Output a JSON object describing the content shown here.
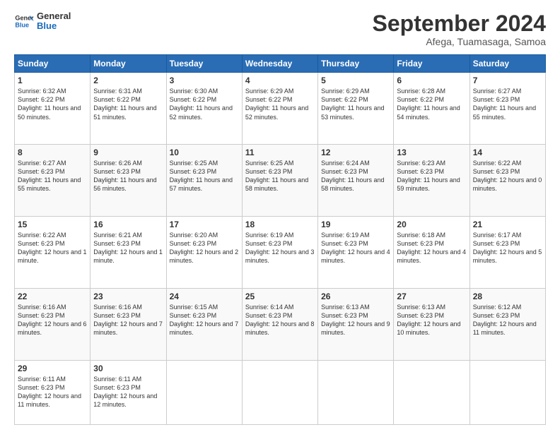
{
  "header": {
    "logo_text_general": "General",
    "logo_text_blue": "Blue",
    "title": "September 2024",
    "subtitle": "Afega, Tuamasaga, Samoa"
  },
  "weekdays": [
    "Sunday",
    "Monday",
    "Tuesday",
    "Wednesday",
    "Thursday",
    "Friday",
    "Saturday"
  ],
  "weeks": [
    [
      {
        "day": "1",
        "sunrise": "6:32 AM",
        "sunset": "6:22 PM",
        "daylight": "11 hours and 50 minutes."
      },
      {
        "day": "2",
        "sunrise": "6:31 AM",
        "sunset": "6:22 PM",
        "daylight": "11 hours and 51 minutes."
      },
      {
        "day": "3",
        "sunrise": "6:30 AM",
        "sunset": "6:22 PM",
        "daylight": "11 hours and 52 minutes."
      },
      {
        "day": "4",
        "sunrise": "6:29 AM",
        "sunset": "6:22 PM",
        "daylight": "11 hours and 52 minutes."
      },
      {
        "day": "5",
        "sunrise": "6:29 AM",
        "sunset": "6:22 PM",
        "daylight": "11 hours and 53 minutes."
      },
      {
        "day": "6",
        "sunrise": "6:28 AM",
        "sunset": "6:22 PM",
        "daylight": "11 hours and 54 minutes."
      },
      {
        "day": "7",
        "sunrise": "6:27 AM",
        "sunset": "6:23 PM",
        "daylight": "11 hours and 55 minutes."
      }
    ],
    [
      {
        "day": "8",
        "sunrise": "6:27 AM",
        "sunset": "6:23 PM",
        "daylight": "11 hours and 55 minutes."
      },
      {
        "day": "9",
        "sunrise": "6:26 AM",
        "sunset": "6:23 PM",
        "daylight": "11 hours and 56 minutes."
      },
      {
        "day": "10",
        "sunrise": "6:25 AM",
        "sunset": "6:23 PM",
        "daylight": "11 hours and 57 minutes."
      },
      {
        "day": "11",
        "sunrise": "6:25 AM",
        "sunset": "6:23 PM",
        "daylight": "11 hours and 58 minutes."
      },
      {
        "day": "12",
        "sunrise": "6:24 AM",
        "sunset": "6:23 PM",
        "daylight": "11 hours and 58 minutes."
      },
      {
        "day": "13",
        "sunrise": "6:23 AM",
        "sunset": "6:23 PM",
        "daylight": "11 hours and 59 minutes."
      },
      {
        "day": "14",
        "sunrise": "6:22 AM",
        "sunset": "6:23 PM",
        "daylight": "12 hours and 0 minutes."
      }
    ],
    [
      {
        "day": "15",
        "sunrise": "6:22 AM",
        "sunset": "6:23 PM",
        "daylight": "12 hours and 1 minute."
      },
      {
        "day": "16",
        "sunrise": "6:21 AM",
        "sunset": "6:23 PM",
        "daylight": "12 hours and 1 minute."
      },
      {
        "day": "17",
        "sunrise": "6:20 AM",
        "sunset": "6:23 PM",
        "daylight": "12 hours and 2 minutes."
      },
      {
        "day": "18",
        "sunrise": "6:19 AM",
        "sunset": "6:23 PM",
        "daylight": "12 hours and 3 minutes."
      },
      {
        "day": "19",
        "sunrise": "6:19 AM",
        "sunset": "6:23 PM",
        "daylight": "12 hours and 4 minutes."
      },
      {
        "day": "20",
        "sunrise": "6:18 AM",
        "sunset": "6:23 PM",
        "daylight": "12 hours and 4 minutes."
      },
      {
        "day": "21",
        "sunrise": "6:17 AM",
        "sunset": "6:23 PM",
        "daylight": "12 hours and 5 minutes."
      }
    ],
    [
      {
        "day": "22",
        "sunrise": "6:16 AM",
        "sunset": "6:23 PM",
        "daylight": "12 hours and 6 minutes."
      },
      {
        "day": "23",
        "sunrise": "6:16 AM",
        "sunset": "6:23 PM",
        "daylight": "12 hours and 7 minutes."
      },
      {
        "day": "24",
        "sunrise": "6:15 AM",
        "sunset": "6:23 PM",
        "daylight": "12 hours and 7 minutes."
      },
      {
        "day": "25",
        "sunrise": "6:14 AM",
        "sunset": "6:23 PM",
        "daylight": "12 hours and 8 minutes."
      },
      {
        "day": "26",
        "sunrise": "6:13 AM",
        "sunset": "6:23 PM",
        "daylight": "12 hours and 9 minutes."
      },
      {
        "day": "27",
        "sunrise": "6:13 AM",
        "sunset": "6:23 PM",
        "daylight": "12 hours and 10 minutes."
      },
      {
        "day": "28",
        "sunrise": "6:12 AM",
        "sunset": "6:23 PM",
        "daylight": "12 hours and 11 minutes."
      }
    ],
    [
      {
        "day": "29",
        "sunrise": "6:11 AM",
        "sunset": "6:23 PM",
        "daylight": "12 hours and 11 minutes."
      },
      {
        "day": "30",
        "sunrise": "6:11 AM",
        "sunset": "6:23 PM",
        "daylight": "12 hours and 12 minutes."
      },
      null,
      null,
      null,
      null,
      null
    ]
  ]
}
